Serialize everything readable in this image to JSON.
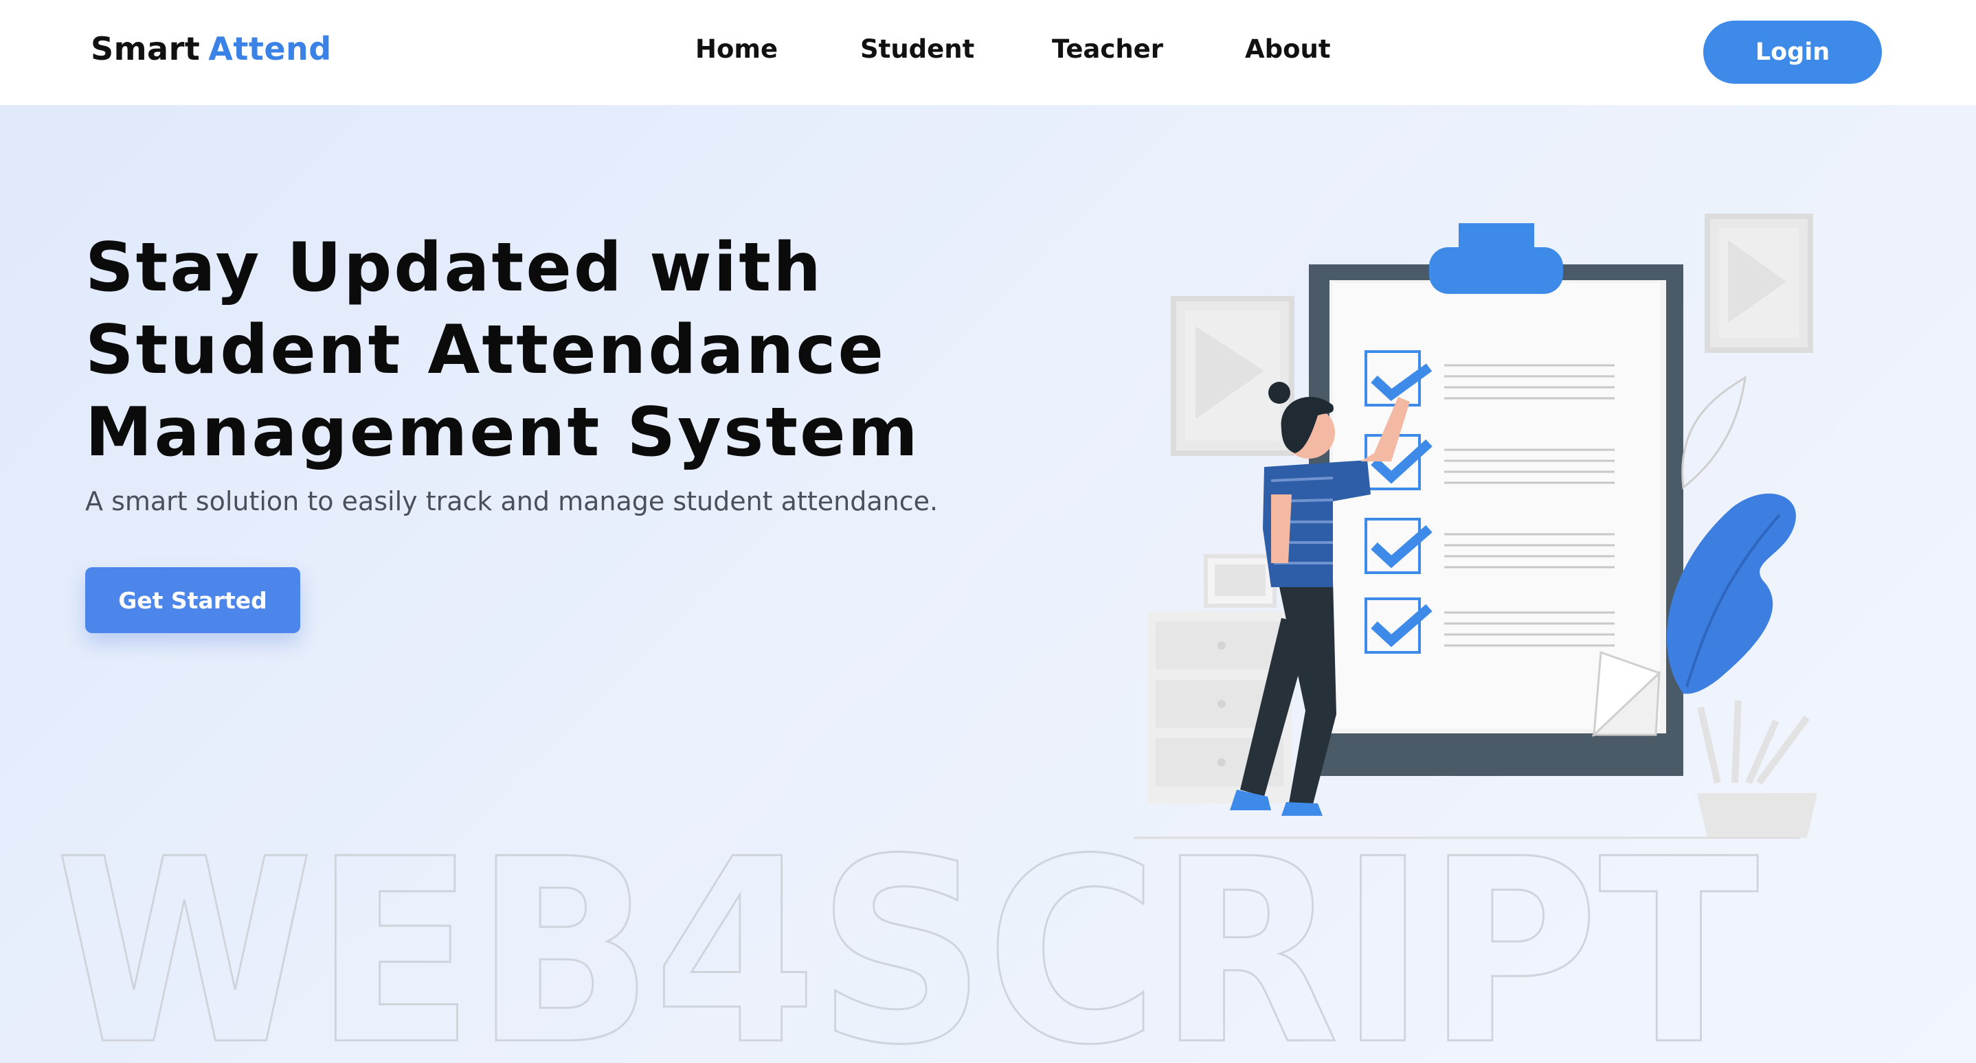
{
  "navbar": {
    "logo_part1": "Smart",
    "logo_part2": "Attend",
    "links": [
      "Home",
      "Student",
      "Teacher",
      "About"
    ],
    "login_label": "Login"
  },
  "hero": {
    "title_lines": [
      "Stay Updated with",
      "Student Attendance",
      "Management System"
    ],
    "subtitle": "A smart solution to easily track and manage student attendance.",
    "cta_label": "Get Started"
  },
  "watermark": {
    "text": "WEB4SCRIPT"
  },
  "colors": {
    "accent": "#3d8ae8",
    "cta": "#4d86ea",
    "clipboard_frame": "#4a5a66",
    "background_start": "#dfe9fb"
  },
  "illustration": {
    "icons": [
      "clipboard-icon",
      "checkbox-icon",
      "person-icon",
      "plant-icon",
      "picture-frame-icon",
      "drawer-icon",
      "pencil-cup-icon"
    ],
    "checklist_items_checked": 4
  }
}
